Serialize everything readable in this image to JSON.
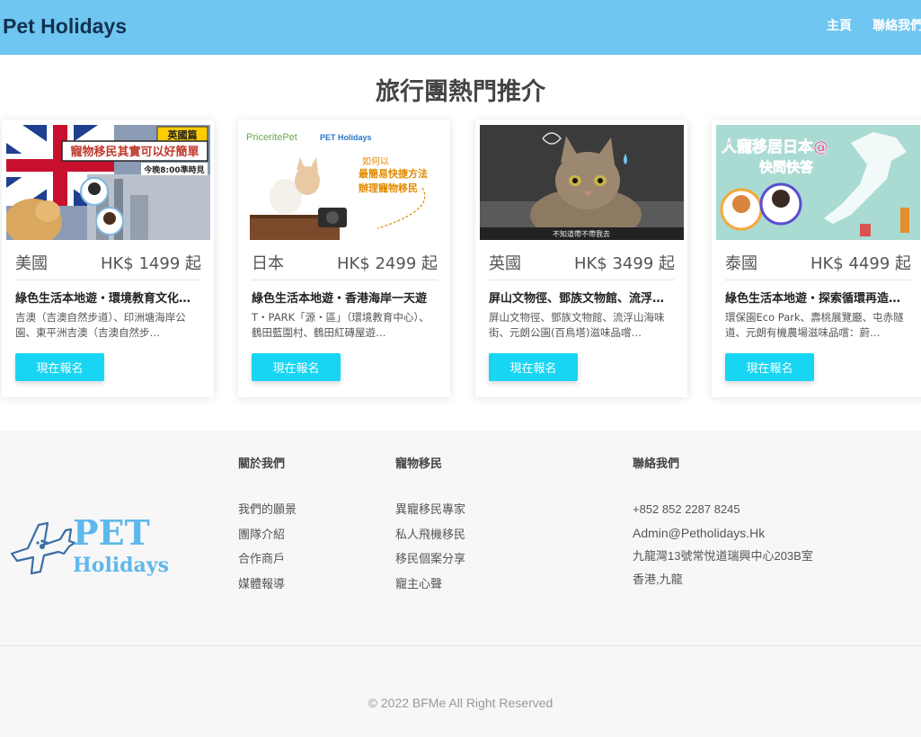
{
  "header": {
    "brand": "Pet Holidays",
    "nav": [
      "主頁",
      "聯絡我們"
    ]
  },
  "main": {
    "section_title": "旅行團熱門推介",
    "cards": [
      {
        "country": "美國",
        "price": "HK$ 1499 起",
        "name": "綠色生活本地遊・環境教育文化…",
        "desc": "吉澳（吉澳自然步道）、印洲塘海岸公園、東平洲吉澳（吉澳自然步…",
        "button": "現在報名",
        "image_text": [
          "英國篇",
          "寵物移民其實可以好簡單",
          "今晚8:00準時見"
        ]
      },
      {
        "country": "日本",
        "price": "HK$ 2499 起",
        "name": "綠色生活本地遊・香港海岸一天遊",
        "desc": "T・PARK「源・區」（環境教育中心）、鶴田藍圍村、鶴田紅磚屋遊…",
        "button": "現在報名",
        "image_text": [
          "PriceritePet",
          "PET Holidays",
          "如何以",
          "最簡易快捷方法",
          "辦理寵物移民"
        ]
      },
      {
        "country": "英國",
        "price": "HK$ 3499 起",
        "name": "屏山文物徑、鄧族文物館、流浮…",
        "desc": "屏山文物徑、鄧族文物館、流浮山海味街、元朗公園(百鳥塔)滋味品嚐…",
        "button": "現在報名",
        "image_text": [
          "不知道帶不帶我去"
        ]
      },
      {
        "country": "泰國",
        "price": "HK$ 4499 起",
        "name": "綠色生活本地遊・探索循環再造…",
        "desc": "環保園Eco Park、壽桃展覽廳、屯赤隧道、元朗有機農場滋味品嚐：蔚…",
        "button": "現在報名",
        "image_text": [
          "人寵移居日本@",
          "快問快答"
        ]
      }
    ]
  },
  "footer": {
    "logo_text": [
      "PET",
      "Holidays"
    ],
    "about": {
      "title": "關於我們",
      "links": [
        "我們的願景",
        "團隊介紹",
        "合作商戶",
        "媒體報導"
      ]
    },
    "migration": {
      "title": "寵物移民",
      "links": [
        "異寵移民專家",
        "私人飛機移民",
        "移民個案分享",
        "寵主心聲"
      ]
    },
    "contact": {
      "title": "聯絡我們",
      "phone": "+852 852 2287 8245",
      "email": "Admin@Petholidays.Hk",
      "address1": "九龍灣13號常悅道瑞興中心203B室",
      "address2": "香港,九龍"
    },
    "copyright": "© 2022 BFMe All Right Reserved"
  },
  "colors": {
    "header_bg": "#6ec6f1",
    "brand_text": "#13314f",
    "button": "#18d5f3",
    "logo_blue": "#5fb8ec"
  }
}
